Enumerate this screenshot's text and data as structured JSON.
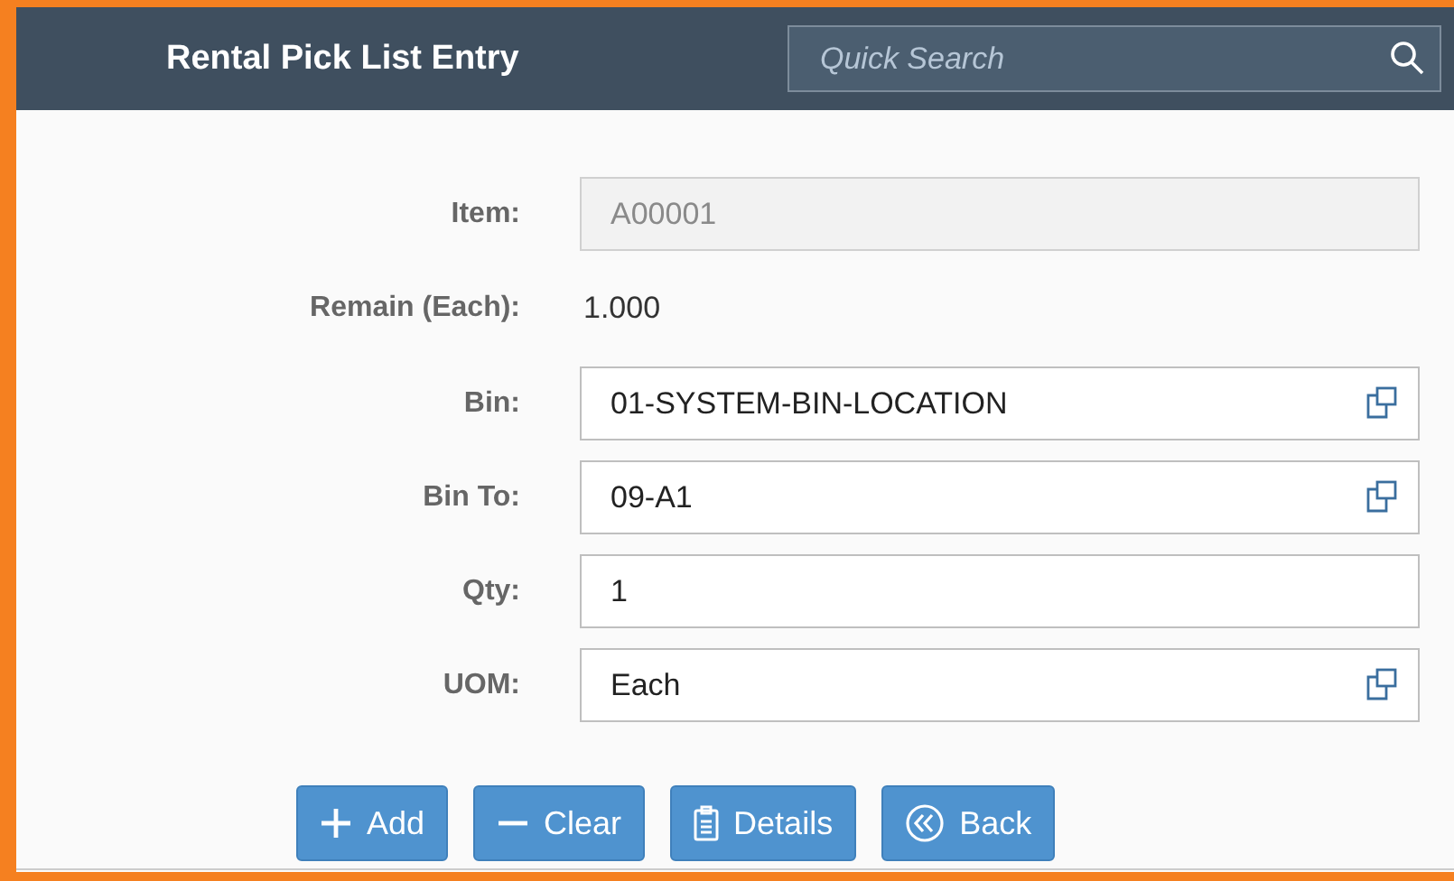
{
  "header": {
    "title": "Rental Pick List Entry",
    "search": {
      "placeholder": "Quick Search"
    }
  },
  "form": [
    {
      "kind": "field",
      "label": "Item:",
      "value": "A00001",
      "disabled": true,
      "lookup": false
    },
    {
      "kind": "text",
      "label": "Remain (Each):",
      "value": "1.000"
    },
    {
      "kind": "field",
      "label": "Bin:",
      "value": "01-SYSTEM-BIN-LOCATION",
      "disabled": false,
      "lookup": true
    },
    {
      "kind": "field",
      "label": "Bin To:",
      "value": "09-A1",
      "disabled": false,
      "lookup": true
    },
    {
      "kind": "field",
      "label": "Qty:",
      "value": "1",
      "disabled": false,
      "lookup": false
    },
    {
      "kind": "field",
      "label": "UOM:",
      "value": "Each",
      "disabled": false,
      "lookup": true
    }
  ],
  "buttons": [
    {
      "kind": "add",
      "label": "Add"
    },
    {
      "kind": "clear",
      "label": "Clear"
    },
    {
      "kind": "details",
      "label": "Details"
    },
    {
      "kind": "back",
      "label": "Back"
    }
  ]
}
